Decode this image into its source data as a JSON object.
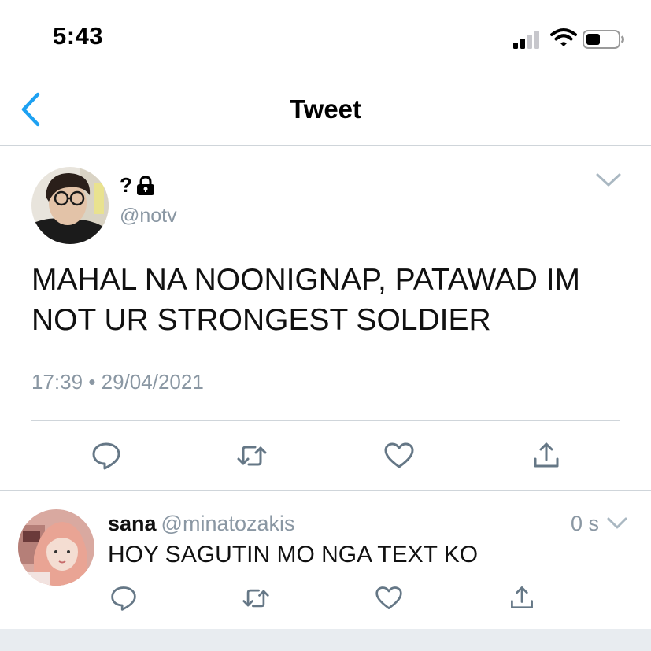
{
  "status_bar": {
    "time": "5:43"
  },
  "nav": {
    "title": "Tweet"
  },
  "tweet": {
    "display_name": "?",
    "handle": "@notv",
    "text": "MAHAL NA NOONIGNAP, PATAWAD IM NOT UR STRONGEST SOLDIER",
    "time": "17:39",
    "separator": "•",
    "date": "29/04/2021",
    "icons": [
      "reply-icon",
      "retweet-icon",
      "like-icon",
      "share-icon"
    ]
  },
  "reply": {
    "display_name": "sana",
    "handle": "@minatozakis",
    "time": "0 s",
    "text": "HOY SAGUTIN MO NGA TEXT KO",
    "icons": [
      "reply-icon",
      "retweet-icon",
      "like-icon",
      "share-icon"
    ]
  },
  "colors": {
    "accent": "#1da1f2",
    "muted": "#8a97a3",
    "icon": "#657786",
    "divider": "#cfd5da"
  }
}
